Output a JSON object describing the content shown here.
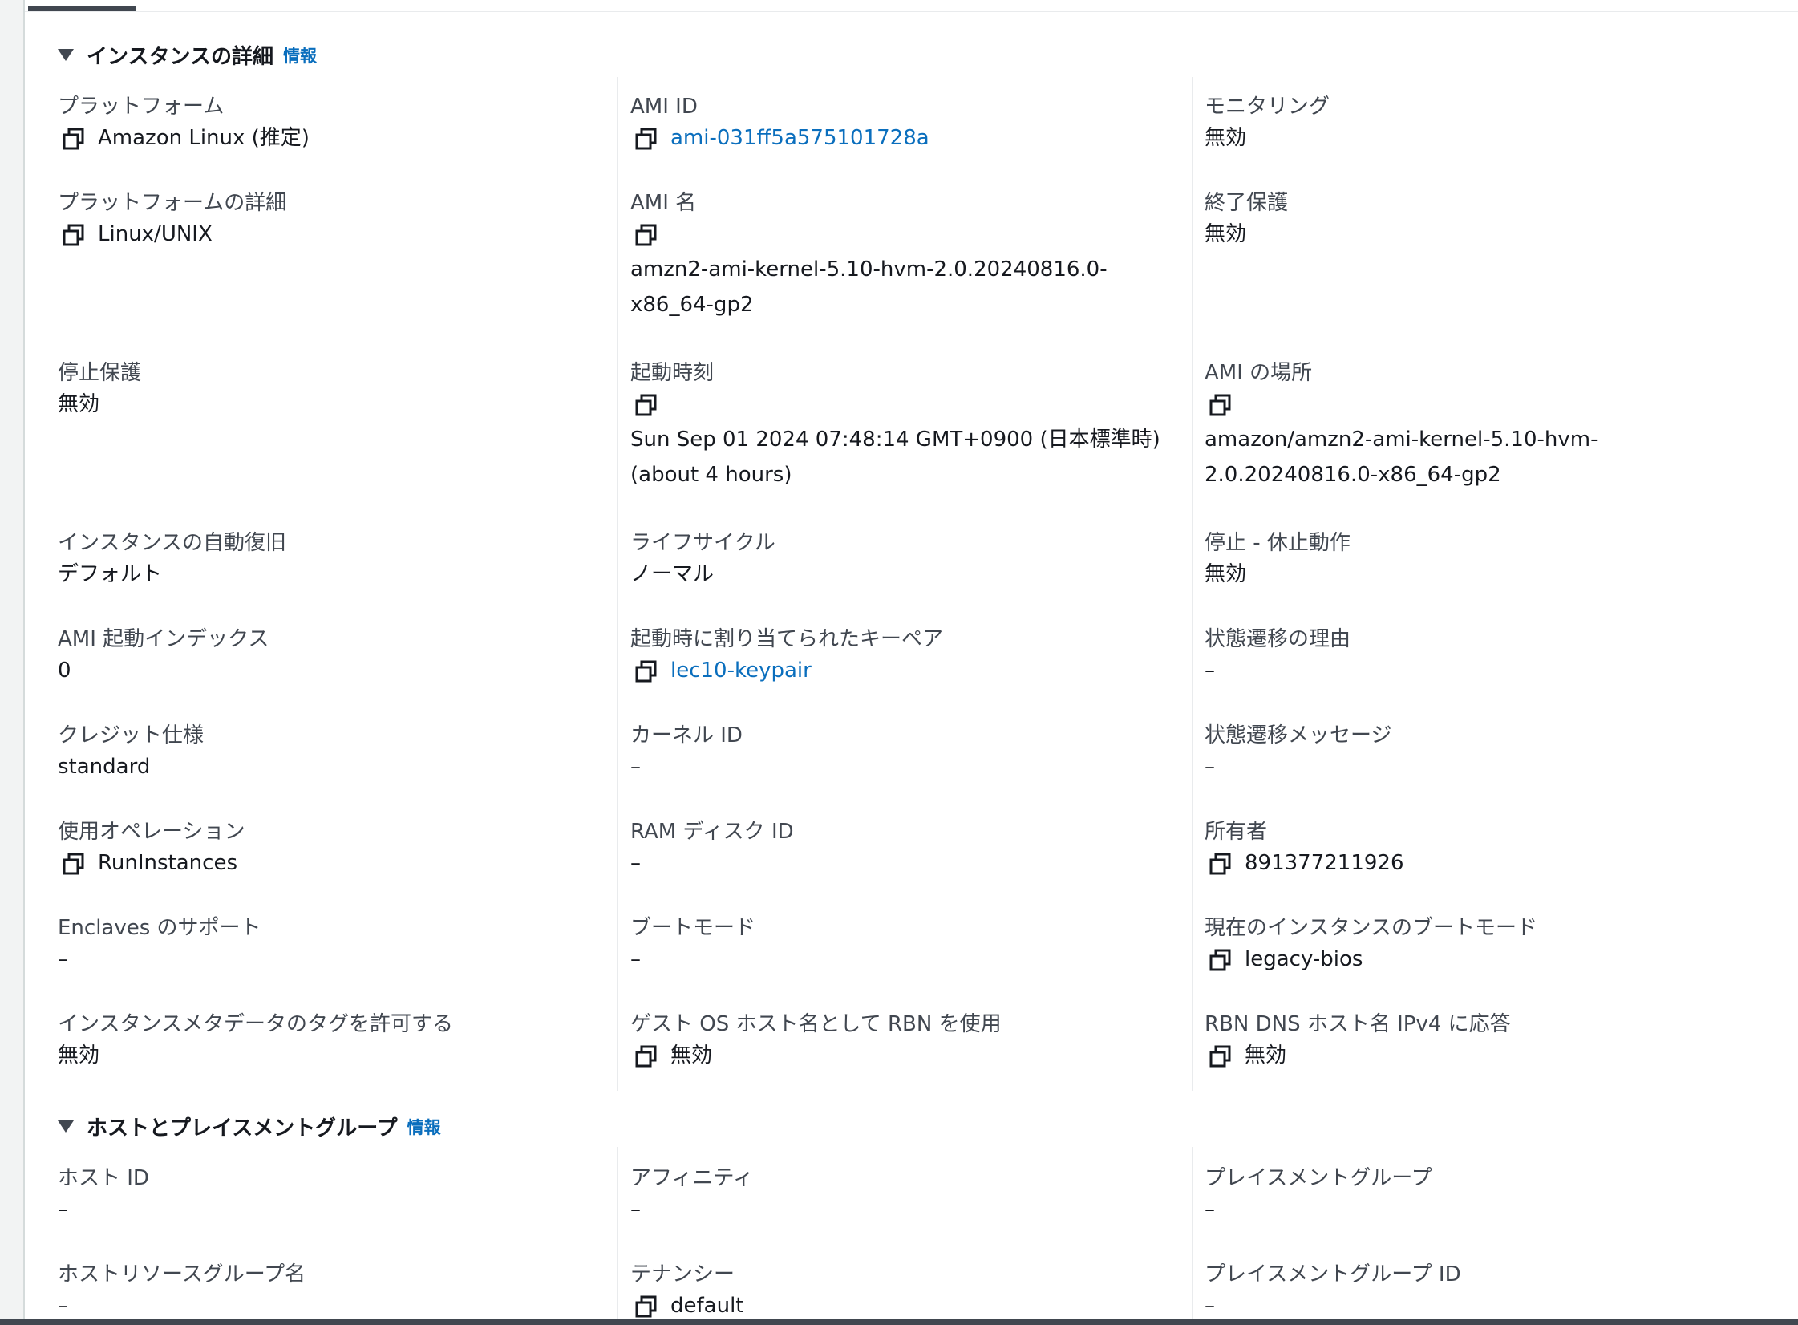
{
  "sections": {
    "instance_details": {
      "title": "インスタンスの詳細",
      "info": "情報"
    },
    "host_placement": {
      "title": "ホストとプレイスメントグループ",
      "info": "情報"
    }
  },
  "fields": {
    "platform": {
      "label": "プラットフォーム",
      "value": "Amazon Linux (推定)"
    },
    "ami_id": {
      "label": "AMI ID",
      "value": "ami-031ff5a575101728a"
    },
    "monitoring": {
      "label": "モニタリング",
      "value": "無効"
    },
    "platform_details": {
      "label": "プラットフォームの詳細",
      "value": "Linux/UNIX"
    },
    "ami_name": {
      "label": "AMI 名",
      "value_line1": "amzn2-ami-kernel-5.10-hvm-2.0.20240816.0-",
      "value_line2": "x86_64-gp2"
    },
    "termination_protection": {
      "label": "終了保護",
      "value": "無効"
    },
    "stop_protection": {
      "label": "停止保護",
      "value": "無効"
    },
    "launch_time": {
      "label": "起動時刻",
      "value_line1": "Sun Sep 01 2024 07:48:14 GMT+0900 (日本標準時)",
      "value_line2": "(about 4 hours)"
    },
    "ami_location": {
      "label": "AMI の場所",
      "value_line1": "amazon/amzn2-ami-kernel-5.10-hvm-",
      "value_line2": "2.0.20240816.0-x86_64-gp2"
    },
    "auto_recovery": {
      "label": "インスタンスの自動復旧",
      "value": "デフォルト"
    },
    "lifecycle": {
      "label": "ライフサイクル",
      "value": "ノーマル"
    },
    "stop_hibernate": {
      "label": "停止 - 休止動作",
      "value": "無効"
    },
    "ami_launch_index": {
      "label": "AMI 起動インデックス",
      "value": "0"
    },
    "key_pair": {
      "label": "起動時に割り当てられたキーペア",
      "value": "lec10-keypair"
    },
    "state_reason": {
      "label": "状態遷移の理由",
      "value": "–"
    },
    "credit_spec": {
      "label": "クレジット仕様",
      "value": "standard"
    },
    "kernel_id": {
      "label": "カーネル ID",
      "value": "–"
    },
    "state_message": {
      "label": "状態遷移メッセージ",
      "value": "–"
    },
    "usage_operation": {
      "label": "使用オペレーション",
      "value": "RunInstances"
    },
    "ram_disk_id": {
      "label": "RAM ディスク ID",
      "value": "–"
    },
    "owner": {
      "label": "所有者",
      "value": "891377211926"
    },
    "enclaves": {
      "label": "Enclaves のサポート",
      "value": "–"
    },
    "boot_mode": {
      "label": "ブートモード",
      "value": "–"
    },
    "current_boot_mode": {
      "label": "現在のインスタンスのブートモード",
      "value": "legacy-bios"
    },
    "metadata_tags": {
      "label": "インスタンスメタデータのタグを許可する",
      "value": "無効"
    },
    "rbn_hostname": {
      "label": "ゲスト OS ホスト名として RBN を使用",
      "value": "無効"
    },
    "rbn_dns_ipv4": {
      "label": "RBN DNS ホスト名 IPv4 に応答",
      "value": "無効"
    },
    "host_id": {
      "label": "ホスト ID",
      "value": "–"
    },
    "affinity": {
      "label": "アフィニティ",
      "value": "–"
    },
    "placement_group": {
      "label": "プレイスメントグループ",
      "value": "–"
    },
    "host_resource_group": {
      "label": "ホストリソースグループ名",
      "value": "–"
    },
    "tenancy": {
      "label": "テナンシー",
      "value": "default"
    },
    "placement_group_id": {
      "label": "プレイスメントグループ ID",
      "value": "–"
    }
  }
}
